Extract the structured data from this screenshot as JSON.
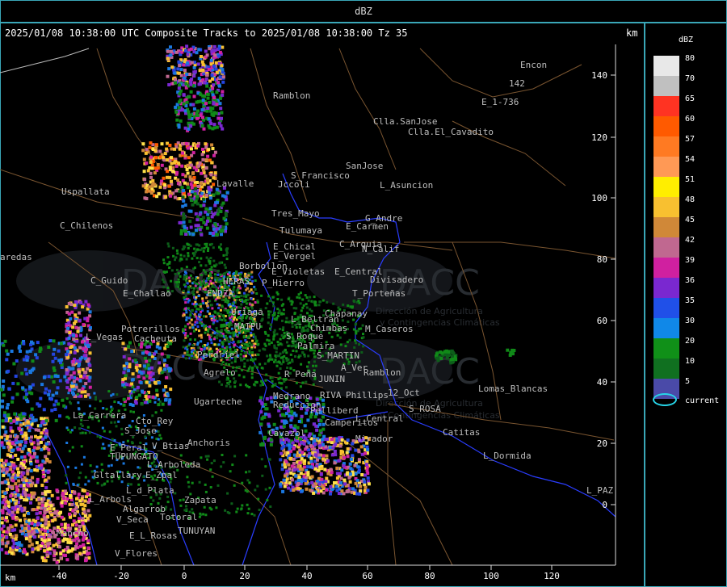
{
  "window": {
    "title": "dBZ"
  },
  "header": {
    "title": "2025/01/08 10:38:00 UTC Composite Tracks to 2025/01/08 10:38:00 Tz 35",
    "km_top": "km",
    "km_bottom": "km"
  },
  "axes": {
    "x_ticks": [
      "-40",
      "-20",
      "0",
      "20",
      "40",
      "60",
      "80",
      "100",
      "120"
    ],
    "y_ticks": [
      "140",
      "120",
      "100",
      "80",
      "60",
      "40",
      "20",
      "0"
    ]
  },
  "legend": {
    "title": "dBZ",
    "levels": [
      {
        "label": "80",
        "color": "#e8e8e8"
      },
      {
        "label": "70",
        "color": "#c0c0c0"
      },
      {
        "label": "65",
        "color": "#ff3322"
      },
      {
        "label": "60",
        "color": "#ff5a00"
      },
      {
        "label": "57",
        "color": "#ff7a22"
      },
      {
        "label": "54",
        "color": "#ff9955"
      },
      {
        "label": "51",
        "color": "#ffee00"
      },
      {
        "label": "48",
        "color": "#f8c030"
      },
      {
        "label": "45",
        "color": "#d08838"
      },
      {
        "label": "42",
        "color": "#c06890"
      },
      {
        "label": "39",
        "color": "#d020a0"
      },
      {
        "label": "36",
        "color": "#7a28d0"
      },
      {
        "label": "35",
        "color": "#2050e8"
      },
      {
        "label": "30",
        "color": "#1088e8"
      },
      {
        "label": "20",
        "color": "#109018"
      },
      {
        "label": "10",
        "color": "#107020"
      },
      {
        "label": "5",
        "color": "#4a4aa8"
      }
    ],
    "current_label": "current",
    "current_color": "#27d4e8"
  },
  "watermarks": [
    {
      "text": "DACC"
    },
    {
      "text": "DACC"
    },
    {
      "text": "Dirección de Agricultura"
    },
    {
      "text": "y Contingencias Climáticas"
    },
    {
      "text": "Dirección de Agricultura"
    },
    {
      "text": "y Contingencias Climáticas"
    }
  ],
  "places": [
    "Encon",
    "142",
    "E_1-736",
    "Ramblon",
    "Clla.SanJose",
    "Clla.El_Cavadito",
    "SanJose",
    "S_Francisco",
    "Jccoli",
    "L_Asuncion",
    "Lavalle",
    "Uspallata",
    "Tres_Mayo",
    "G_Andre",
    "Tulumaya",
    "E_Carmen",
    "C_Chilenos",
    "E_Chical",
    "C_Arquia",
    "N_Calif",
    "E_Vergel",
    "aredas",
    "Borbollon",
    "E_Central",
    "E_Violetas",
    "Divisadero",
    "C_Guido",
    "HERAS",
    "P_Hierro",
    "E_Challao",
    "ENDZA",
    "T_Porteñas",
    "Chapanay",
    "Potrerillos",
    "Uriaga",
    "L_Beltran",
    "Chimbas",
    "M_Caseros",
    "L_Vegas",
    "Cacheuta",
    "MAIPU",
    "S_Roque",
    "Palmira",
    "Perdriel",
    "S_MARTIN",
    "Agrelo",
    "A_Ver",
    "Ramblon",
    "R_Peña",
    "JUNIN",
    "Lomas_Blancas",
    "RIVA",
    "Phillips",
    "12_Oct",
    "Ugarteche",
    "Medrano",
    "Reduccion",
    "S_ROSA",
    "La_Carrera",
    "Pelliberd",
    "L_Central",
    "Cto_Rey",
    "Camperitos",
    "S_Jose",
    "Cavazol",
    "Catitas",
    "Mirador",
    "E_Peral",
    "V_Btias",
    "Anchoris",
    "TUPUNGATO",
    "L_Dormida",
    "L_Arboleda",
    "Gltallary",
    "E_Zpal",
    "L_d_Plata",
    "L_PAZ",
    "L_Arbols",
    "Zapata",
    "Algarrob",
    "Totoral",
    "V_Seca",
    "Mancho",
    "E_L_Rosas",
    "TUNUYAN",
    "V_Flores"
  ]
}
